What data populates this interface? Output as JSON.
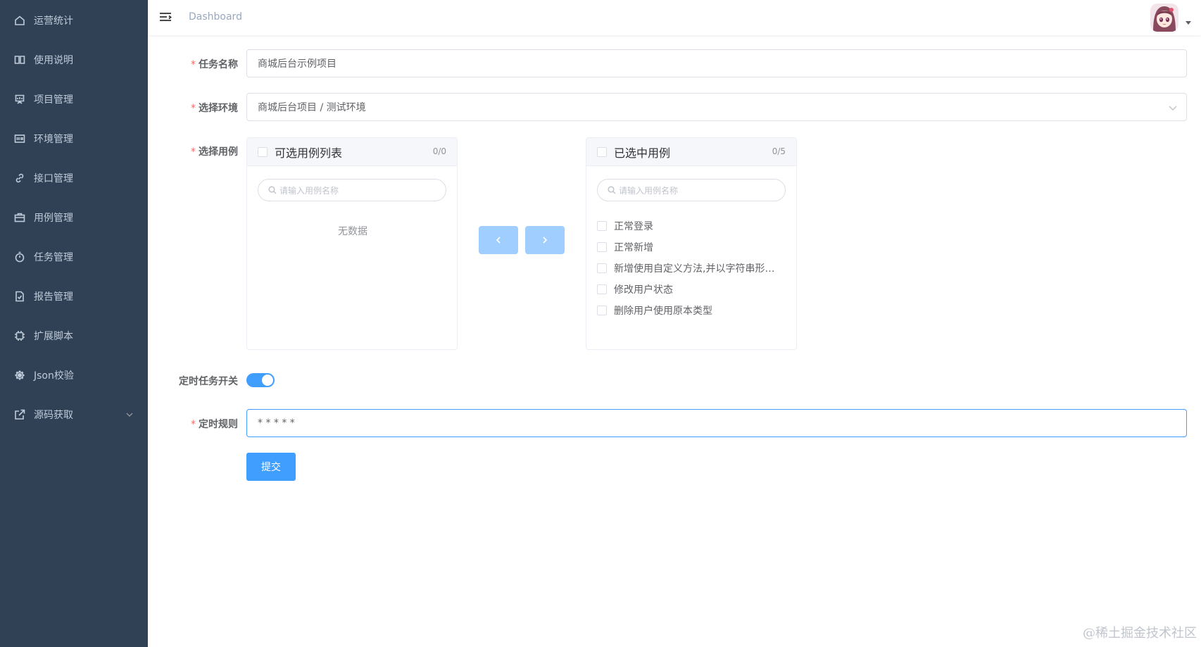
{
  "sidebar": {
    "items": [
      {
        "label": "运营统计",
        "icon": "home-icon"
      },
      {
        "label": "使用说明",
        "icon": "book-icon"
      },
      {
        "label": "项目管理",
        "icon": "presentation-icon"
      },
      {
        "label": "环境管理",
        "icon": "server-icon"
      },
      {
        "label": "接口管理",
        "icon": "link-icon"
      },
      {
        "label": "用例管理",
        "icon": "briefcase-icon"
      },
      {
        "label": "任务管理",
        "icon": "timer-icon"
      },
      {
        "label": "报告管理",
        "icon": "document-icon"
      },
      {
        "label": "扩展脚本",
        "icon": "cpu-icon"
      },
      {
        "label": "Json校验",
        "icon": "gear-icon"
      },
      {
        "label": "源码获取",
        "icon": "external-link-icon"
      }
    ]
  },
  "navbar": {
    "breadcrumb": "Dashboard"
  },
  "form": {
    "task_name": {
      "label": "任务名称",
      "value": "商城后台示例项目"
    },
    "env": {
      "label": "选择环境",
      "value": "商城后台项目 / 测试环境"
    },
    "cases": {
      "label": "选择用例"
    },
    "schedule_switch": {
      "label": "定时任务开关",
      "on": true
    },
    "cron": {
      "label": "定时规则",
      "value": "* * * * *"
    },
    "submit_label": "提交"
  },
  "transfer": {
    "left": {
      "title": "可选用例列表",
      "count": "0/0",
      "placeholder": "请输入用例名称",
      "empty_text": "无数据"
    },
    "right": {
      "title": "已选中用例",
      "count": "0/5",
      "placeholder": "请输入用例名称",
      "items": [
        "正常登录",
        "正常新增",
        "新增使用自定义方法,并以字符串形…",
        "修改用户状态",
        "删除用户使用原本类型"
      ]
    }
  },
  "watermark": "@稀土掘金技术社区",
  "colors": {
    "sidebar_bg": "#304156",
    "sidebar_text": "#bfcbd9",
    "primary": "#409eff",
    "primary_light": "#a0cfff",
    "required": "#f56c6c"
  }
}
